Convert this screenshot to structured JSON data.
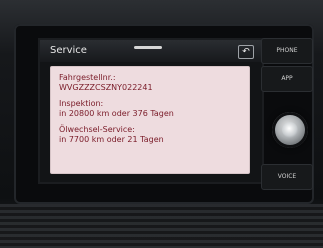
{
  "screen": {
    "title": "Service",
    "back_icon_glyph": "↶",
    "sections": [
      {
        "label": "Fahrgestellnr.:",
        "value": "WVGZZZCSZNY022241"
      },
      {
        "label": "Inspektion:",
        "value": "in 20800 km oder 376 Tagen"
      },
      {
        "label": "Ölwechsel-Service:",
        "value": "in 7700 km oder 21 Tagen"
      }
    ]
  },
  "hardware_buttons": {
    "phone": "PHONE",
    "app": "APP",
    "voice": "VOICE"
  },
  "colors": {
    "panel_bg": "#eedcdf",
    "panel_text": "#7a1b28",
    "header_text": "#e7e7e7"
  },
  "icons": {
    "back": "back-arrow-icon",
    "knob": "volume-knob-icon"
  }
}
